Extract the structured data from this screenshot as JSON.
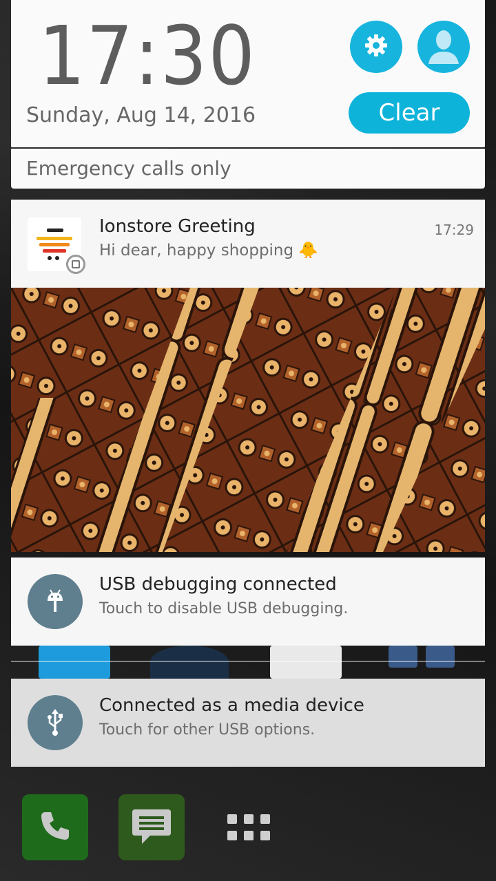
{
  "header": {
    "time_hours": "17",
    "time_colon": ":",
    "time_minutes": "30",
    "date": "Sunday, Aug 14, 2016",
    "clear_label": "Clear",
    "settings_icon": "gear-icon",
    "profile_icon": "user-avatar-icon",
    "accent_color": "#17b4dd"
  },
  "status": {
    "emergency": "Emergency calls only"
  },
  "notifications": [
    {
      "app_icon": "ionstore-cart-icon",
      "title": "Ionstore Greeting",
      "text": "Hi dear, happy shopping 🐥",
      "time": "17:29",
      "image": "batik-pattern-image"
    },
    {
      "icon": "android-debug-icon",
      "title": "USB debugging connected",
      "text": "Touch to disable USB debugging."
    },
    {
      "icon": "usb-icon",
      "title": "Connected as a media device",
      "text": "Touch for other USB options."
    }
  ],
  "dock": {
    "phone_icon": "phone-icon",
    "messages_icon": "messages-icon",
    "apps_icon": "app-drawer-icon"
  }
}
